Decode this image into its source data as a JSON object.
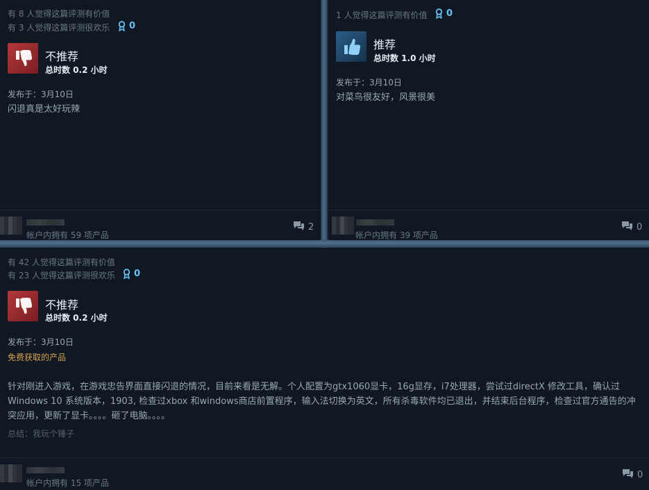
{
  "reviews": [
    {
      "helpful_text": "有 8 人觉得这篇评测有价值",
      "funny_text": "有 3 人觉得这篇评测很欢乐",
      "awards": "0",
      "verdict": "不推荐",
      "verdict_icon": "thumbs-down-icon",
      "hours": "总时数 0.2 小时",
      "posted": "发布于：3月10日",
      "content": "闪退真是太好玩辣",
      "owned": "帐户内拥有 59 项产品",
      "comments": "2"
    },
    {
      "helpful_text": "1 人觉得这篇评测有价值",
      "awards": "0",
      "verdict": "推荐",
      "verdict_icon": "thumbs-up-icon",
      "hours": "总时数 1.0 小时",
      "posted": "发布于：3月10日",
      "content": "对菜鸟很友好，风景很美",
      "owned": "帐户内拥有 39 项产品",
      "comments": "0"
    },
    {
      "helpful_text": "有 42 人觉得这篇评测有价值",
      "funny_text": "有 23 人觉得这篇评测很欢乐",
      "awards": "0",
      "verdict": "不推荐",
      "verdict_icon": "thumbs-down-icon",
      "hours": "总时数 0.2 小时",
      "posted": "发布于：3月10日",
      "free_label": "免费获取的产品",
      "content": "针对刚进入游戏，在游戏忠告界面直接闪退的情况，目前来看是无解。个人配置为gtx1060显卡，16g显存，i7处理器，尝试过directX 修改工具，确认过Windows 10 系统版本，1903, 检查过xbox 和windows商店前置程序，输入法切换为英文，所有杀毒软件均已退出，并结束后台程序，检查过官方通告的冲突应用，更新了显卡。。。。砸了电脑。。。。",
      "summary": "总结：我玩个锤子",
      "owned": "帐户内拥有 15 项产品",
      "comments": "0"
    }
  ],
  "colors": {
    "card_bg": "#0f1823",
    "accent": "#66c0f4",
    "free_product": "#d4a24a",
    "thumb_down_bg": "#b3383a",
    "thumb_up_bg": "#2a5d86"
  }
}
